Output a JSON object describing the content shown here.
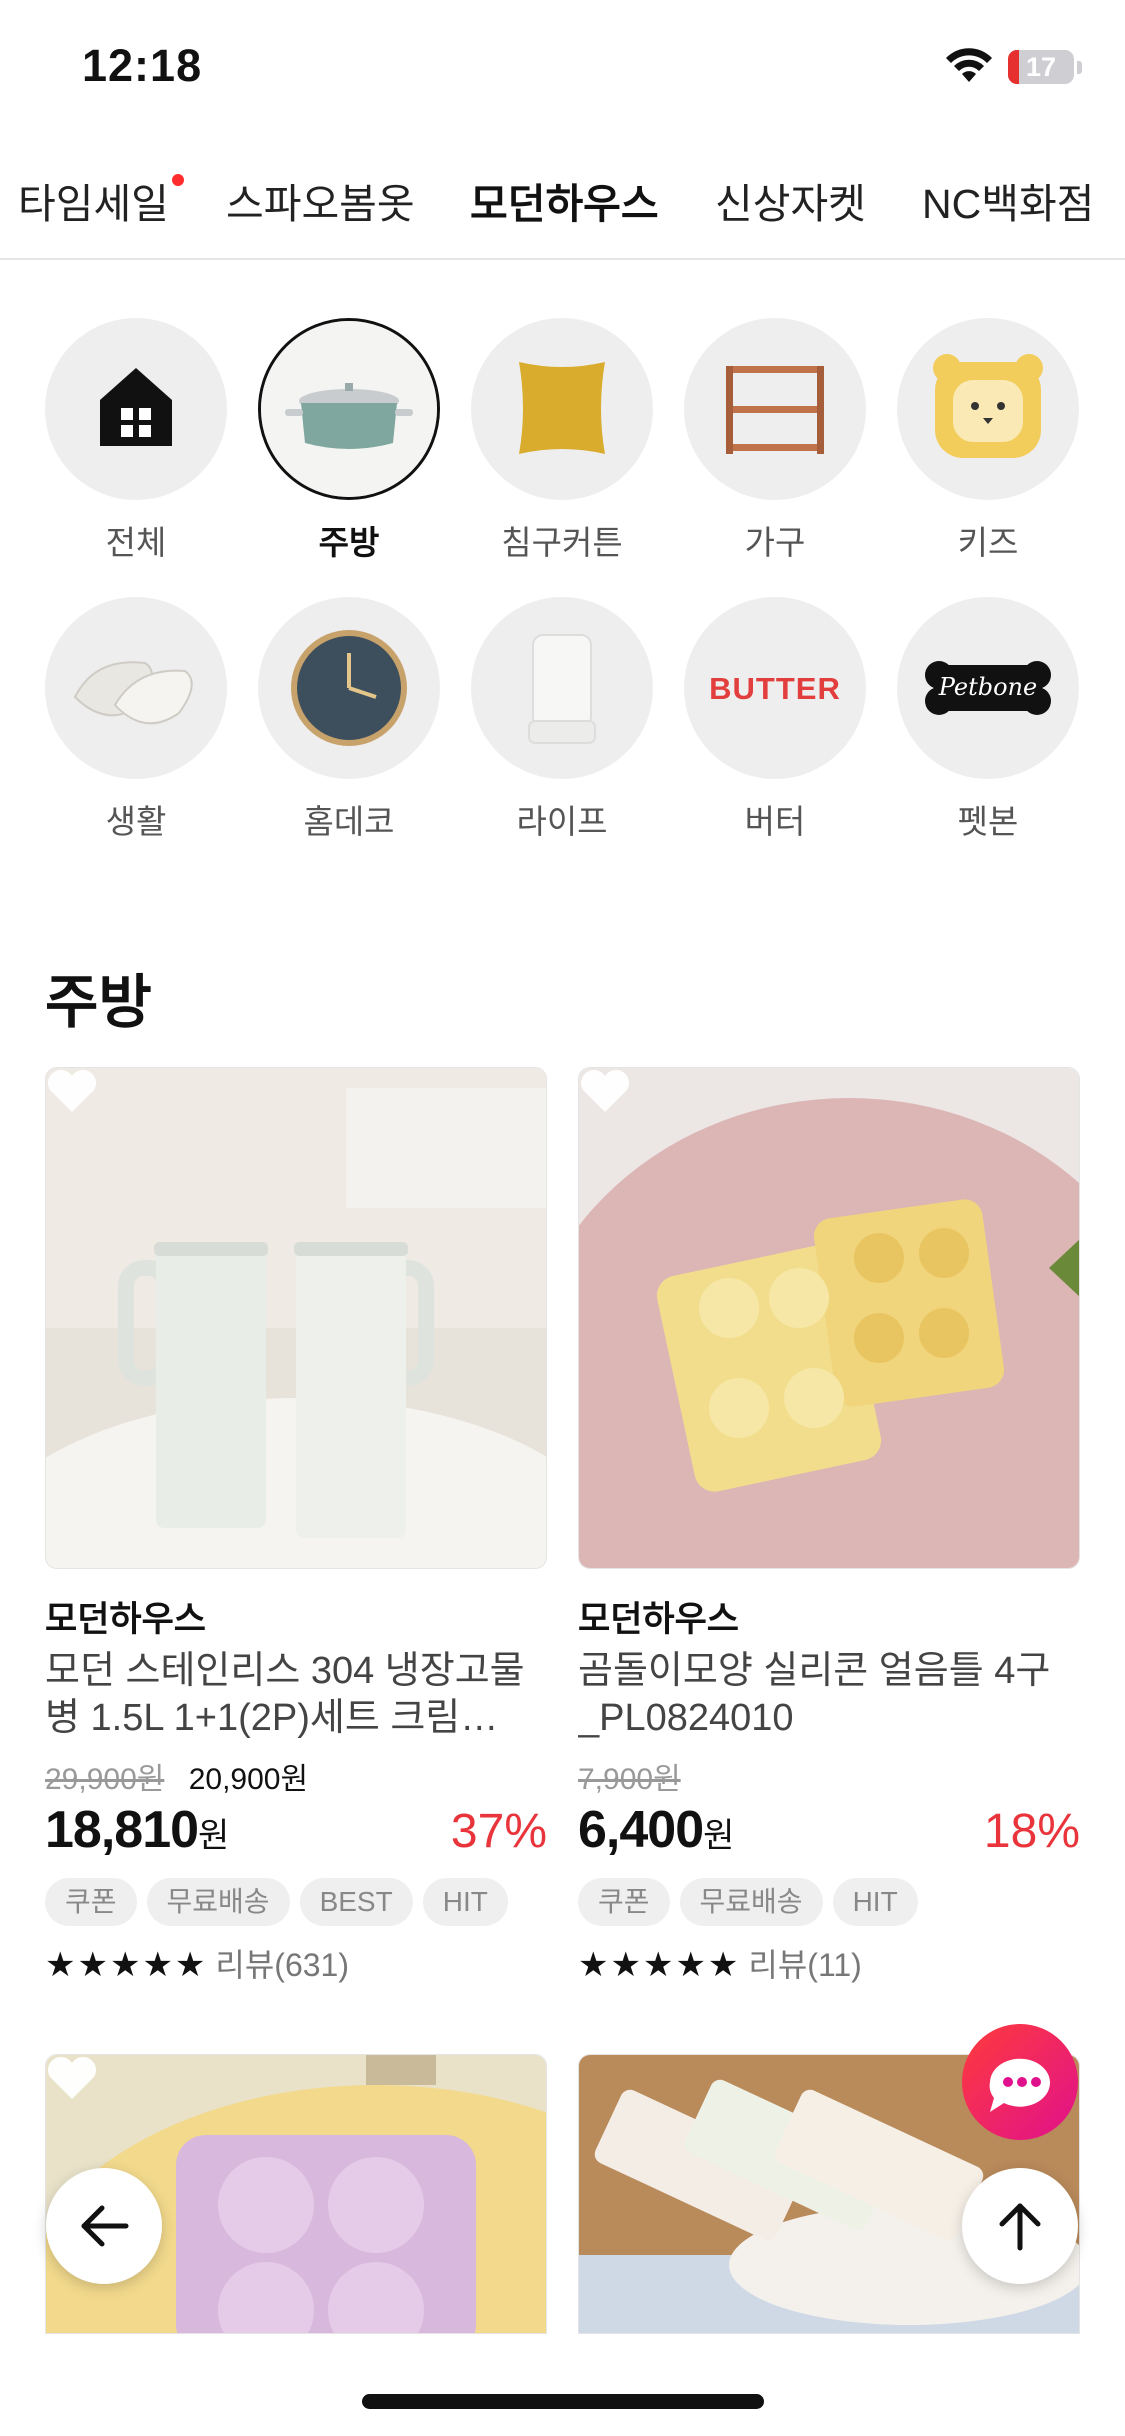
{
  "status": {
    "time": "12:18",
    "battery": "17",
    "battery_level": 0.17
  },
  "top_tabs": [
    {
      "label": "타임세일",
      "has_dot": true
    },
    {
      "label": "스파오봄옷"
    },
    {
      "label": "모던하우스",
      "active": true
    },
    {
      "label": "신상자켓"
    },
    {
      "label": "NC백화점"
    }
  ],
  "categories": [
    {
      "label": "전체",
      "icon": "house-grid-icon"
    },
    {
      "label": "주방",
      "icon": "pot-icon",
      "active": true
    },
    {
      "label": "침구커튼",
      "icon": "cushion-icon"
    },
    {
      "label": "가구",
      "icon": "shelf-icon"
    },
    {
      "label": "키즈",
      "icon": "tiger-plate-icon"
    },
    {
      "label": "생활",
      "icon": "slippers-icon"
    },
    {
      "label": "홈데코",
      "icon": "clock-icon"
    },
    {
      "label": "라이프",
      "icon": "humidifier-icon"
    },
    {
      "label": "버터",
      "icon": "butter-logo",
      "logo_text": "BUTTER"
    },
    {
      "label": "펫본",
      "icon": "petbone-logo",
      "logo_text": "Petbone"
    }
  ],
  "section_title": "주방",
  "products": [
    {
      "brand": "모던하우스",
      "name": "모던 스테인리스 304 냉장고물병 1.5L 1+1(2P)세트 크림…",
      "original_price": "29,900원",
      "sale_price": "20,900원",
      "final_price": "18,810",
      "currency": "원",
      "discount": "37%",
      "tags": [
        "쿠폰",
        "무료배송",
        "BEST",
        "HIT"
      ],
      "stars": "★★★★★",
      "review": "리뷰(631)"
    },
    {
      "brand": "모던하우스",
      "name": "곰돌이모양 실리콘 얼음틀 4구_PL0824010",
      "original_price": "7,900원",
      "final_price": "6,400",
      "currency": "원",
      "discount": "18%",
      "tags": [
        "쿠폰",
        "무료배송",
        "HIT"
      ],
      "stars": "★★★★★",
      "review": "리뷰(11)"
    }
  ],
  "colors": {
    "accent_red": "#e8343a",
    "tab_dot": "#ff2d2d",
    "chat_gradient_start": "#ff3b3b",
    "chat_gradient_end": "#e0118c"
  },
  "fab": {
    "back_icon": "arrow-left-icon",
    "top_icon": "arrow-up-icon",
    "chat_icon": "chat-bubble-icon"
  }
}
